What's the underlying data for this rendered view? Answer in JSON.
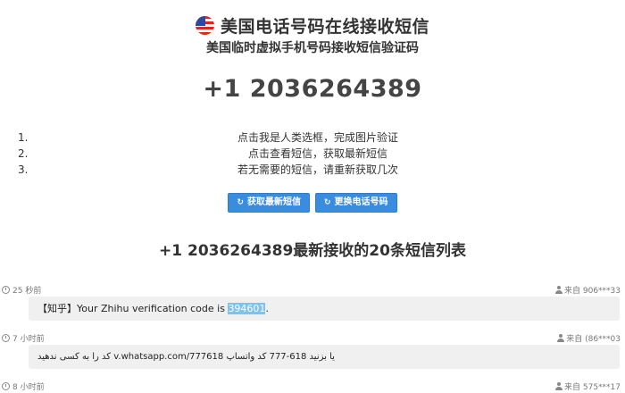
{
  "header": {
    "flag_icon": "us-flag-icon",
    "title": "美国电话号码在线接收短信",
    "subtitle": "美国临时虚拟手机号码接收短信验证码",
    "phone_number": "+1 2036264389"
  },
  "instructions": [
    {
      "num": "1.",
      "text": "点击我是人类选框，完成图片验证"
    },
    {
      "num": "2.",
      "text": "点击查看短信，获取最新短信"
    },
    {
      "num": "3.",
      "text": "若无需要的短信，请重新获取几次"
    }
  ],
  "buttons": {
    "refresh_label": "获取最新短信",
    "change_label": "更换电话号码",
    "icon": "refresh-icon",
    "color": "#3a8dde"
  },
  "list_title": "+1 2036264389最新接收的20条短信列表",
  "messages": [
    {
      "time": "25 秒前",
      "from": "来自 906***33",
      "text_prefix": "【知乎】Your Zhihu verification code is ",
      "code": "394601",
      "text_suffix": "."
    },
    {
      "time": "7 小时前",
      "from": "来自 (86***03",
      "text": "کد را به کسی ندهید v.whatsapp.com/777618 یا بزنید 618-777 کد واتساپ"
    },
    {
      "time": "8 小时前",
      "from": "来自 575***17"
    }
  ]
}
